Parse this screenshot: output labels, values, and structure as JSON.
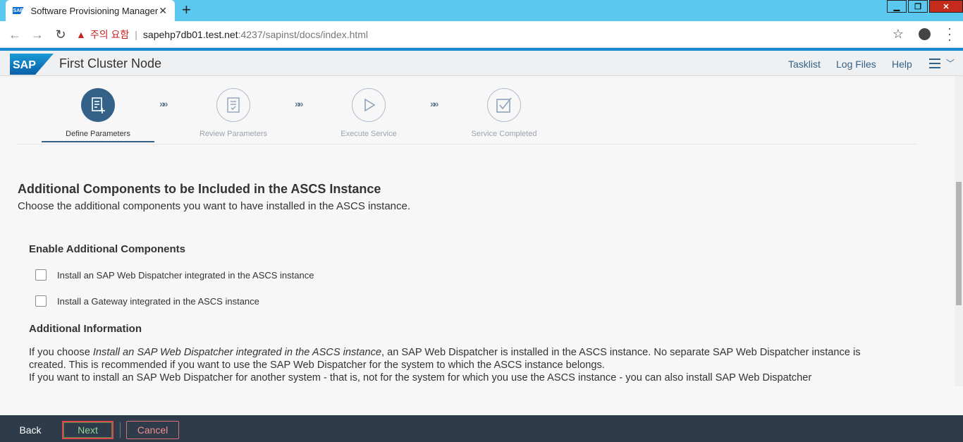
{
  "browser": {
    "tab_title": "Software Provisioning Manager",
    "tab_favicon_text": "SAP",
    "new_tab": "+",
    "security_warning": "주의 요함",
    "url_host": "sapehp7db01.test.net",
    "url_path": ":4237/sapinst/docs/index.html"
  },
  "shell": {
    "logo_text": "SAP",
    "title": "First Cluster Node",
    "links": [
      "Tasklist",
      "Log Files",
      "Help"
    ]
  },
  "wizard": {
    "steps": [
      {
        "label": "Define Parameters",
        "state": "active",
        "icon": "document-plus-icon"
      },
      {
        "label": "Review Parameters",
        "state": "inactive",
        "icon": "document-check-icon"
      },
      {
        "label": "Execute Service",
        "state": "inactive",
        "icon": "play-icon"
      },
      {
        "label": "Service Completed",
        "state": "inactive",
        "icon": "checkbox-checked-icon"
      }
    ],
    "separator": "»»"
  },
  "content": {
    "title": "Additional Components to be Included in the ASCS Instance",
    "subtitle": "Choose the additional components you want to have installed in the ASCS instance.",
    "group_title": "Enable Additional Components",
    "options": [
      {
        "label": "Install an SAP Web Dispatcher integrated in the ASCS instance",
        "checked": false
      },
      {
        "label": "Install a Gateway integrated in the ASCS instance",
        "checked": false
      }
    ],
    "info_title": "Additional Information",
    "info_prefix": "If you choose ",
    "info_emphasis": "Install an SAP Web Dispatcher integrated in the ASCS instance",
    "info_rest": ", an SAP Web Dispatcher is installed in the ASCS instance. No separate SAP Web Dispatcher instance is created. This is recommended if you want to use the SAP Web Dispatcher for the system to which the ASCS instance belongs.",
    "info_line2": "If you want to install an SAP Web Dispatcher for another system - that is, not for the system for which you use the ASCS instance - you can also install SAP Web Dispatcher"
  },
  "footer": {
    "back": "Back",
    "next": "Next",
    "cancel": "Cancel"
  },
  "colors": {
    "accent": "#346187",
    "footer_bg": "#2e3b4a",
    "tabbar_bg": "#5bc8f0"
  }
}
